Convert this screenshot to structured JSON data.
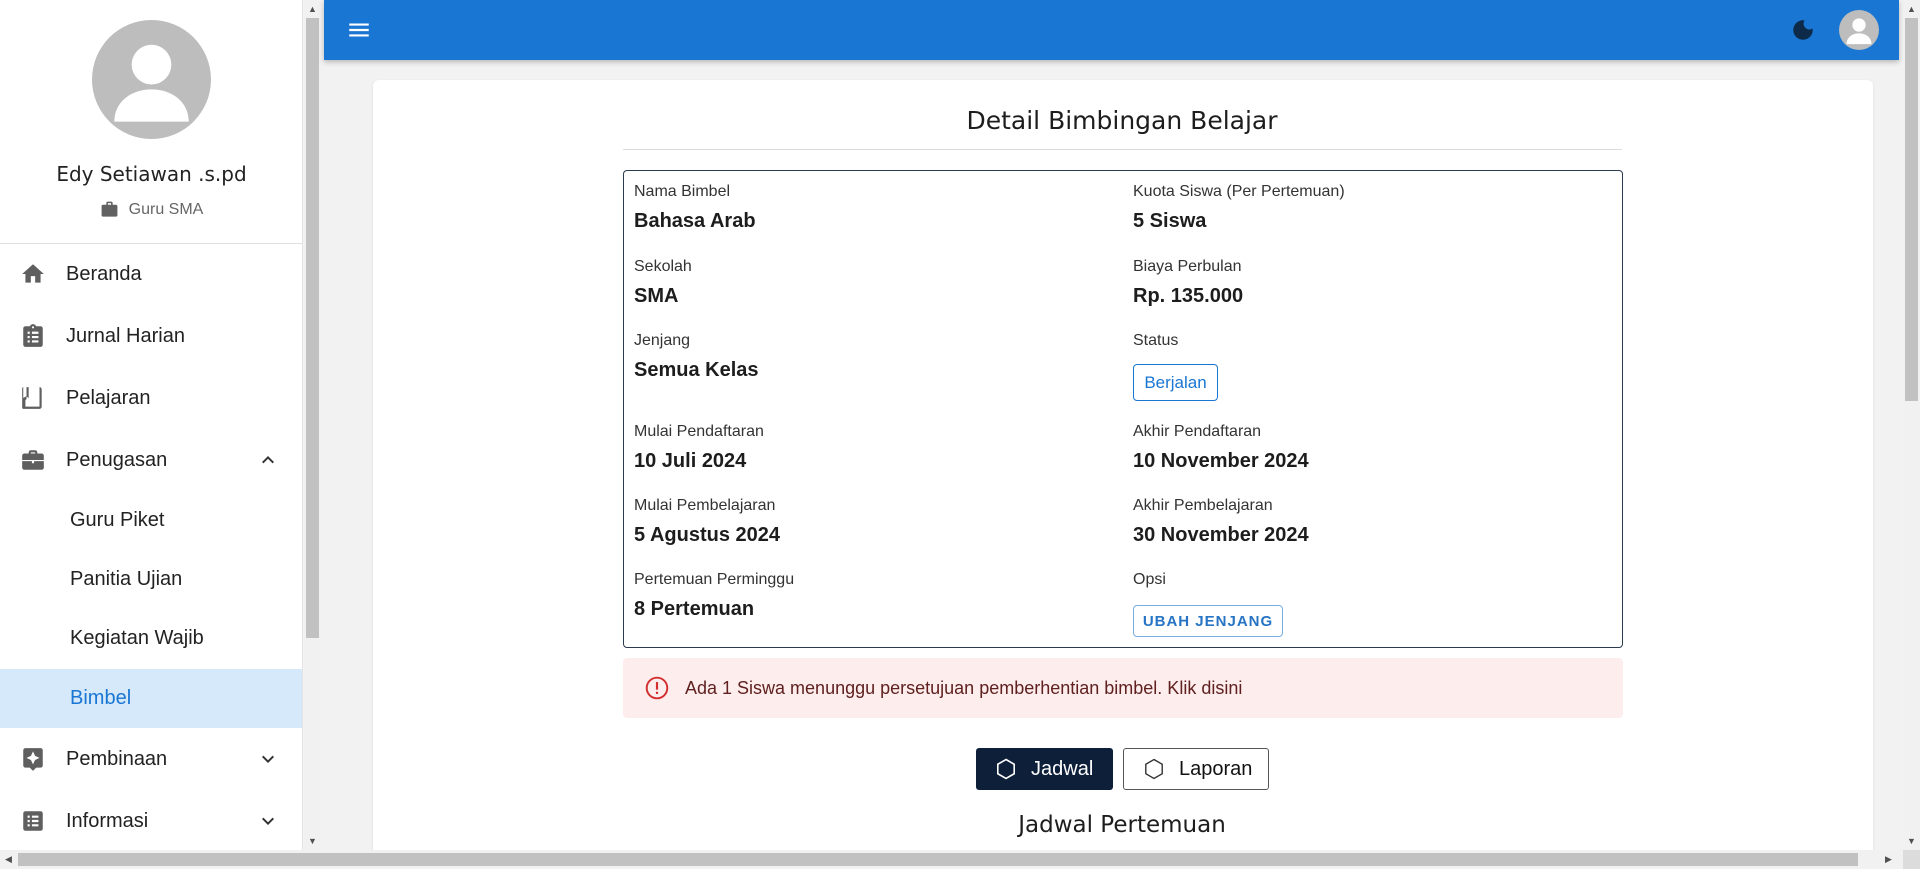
{
  "profile": {
    "name": "Edy Setiawan .s.pd",
    "role": "Guru SMA"
  },
  "nav": {
    "beranda": "Beranda",
    "jurnal": "Jurnal Harian",
    "pelajaran": "Pelajaran",
    "penugasan": "Penugasan",
    "sub": {
      "guru_piket": "Guru Piket",
      "panitia": "Panitia Ujian",
      "kegiatan": "Kegiatan Wajib",
      "bimbel": "Bimbel"
    },
    "pembinaan": "Pembinaan",
    "informasi": "Informasi"
  },
  "page": {
    "title": "Detail Bimbingan Belajar"
  },
  "details": {
    "nama_label": "Nama Bimbel",
    "nama_value": "Bahasa Arab",
    "kuota_label": "Kuota Siswa (Per Pertemuan)",
    "kuota_value": "5 Siswa",
    "sekolah_label": "Sekolah",
    "sekolah_value": "SMA",
    "biaya_label": "Biaya Perbulan",
    "biaya_value": "Rp. 135.000",
    "jenjang_label": "Jenjang",
    "jenjang_value": "Semua Kelas",
    "status_label": "Status",
    "status_value": "Berjalan",
    "mulai_daftar_label": "Mulai Pendaftaran",
    "mulai_daftar_value": "10 Juli 2024",
    "akhir_daftar_label": "Akhir Pendaftaran",
    "akhir_daftar_value": "10 November 2024",
    "mulai_ajar_label": "Mulai Pembelajaran",
    "mulai_ajar_value": "5 Agustus 2024",
    "akhir_ajar_label": "Akhir Pembelajaran",
    "akhir_ajar_value": "30 November 2024",
    "pertemuan_label": "Pertemuan Perminggu",
    "pertemuan_value": "8 Pertemuan",
    "opsi_label": "Opsi",
    "opsi_button": "UBAH JENJANG"
  },
  "alert": {
    "text": "Ada 1 Siswa menunggu persetujuan pemberhentian bimbel. Klik disini"
  },
  "tabs": {
    "jadwal": "Jadwal",
    "laporan": "Laporan"
  },
  "section": {
    "title": "Jadwal Pertemuan"
  },
  "colors": {
    "primary": "#1976d2",
    "active_nav_bg": "#d6e9fb",
    "alert_bg": "#fdeded",
    "alert_icon": "#d32f2f",
    "dark_button": "#0e1f3a"
  }
}
